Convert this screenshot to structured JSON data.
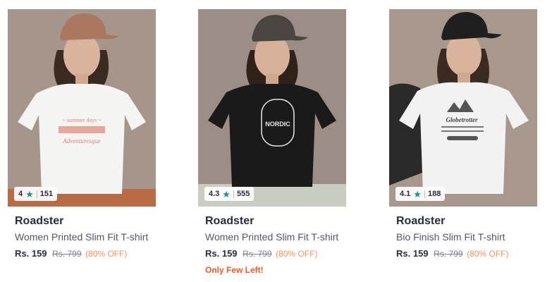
{
  "products": [
    {
      "brand": "Roadster",
      "title": "Women Printed Slim Fit T-shirt",
      "rating": "4",
      "rating_count": "151",
      "price": "Rs. 159",
      "mrp": "Rs. 799",
      "discount": "(80% OFF)",
      "stock_note": "",
      "image": {
        "shirt_color": "#f4f4f2",
        "cap_color": "#a9785f",
        "bottom_color": "#b86a45"
      }
    },
    {
      "brand": "Roadster",
      "title": "Women Printed Slim Fit T-shirt",
      "rating": "4.3",
      "rating_count": "555",
      "price": "Rs. 159",
      "mrp": "Rs. 799",
      "discount": "(80% OFF)",
      "stock_note": "Only Few Left!",
      "image": {
        "shirt_color": "#1a1a1a",
        "cap_color": "#4a4541",
        "bottom_color": "#c9ccc0"
      }
    },
    {
      "brand": "Roadster",
      "title": "Bio Finish Slim Fit T-shirt",
      "rating": "4.1",
      "rating_count": "188",
      "price": "Rs. 159",
      "mrp": "Rs. 799",
      "discount": "(80% OFF)",
      "stock_note": "",
      "image": {
        "shirt_color": "#f2f2f2",
        "cap_color": "#1f1f1f",
        "bottom_color": "#8a7f76"
      }
    }
  ],
  "colors": {
    "rating_star": "#14958f",
    "discount": "#ff905a",
    "few_left": "#ff5722",
    "brand": "#282c3f"
  }
}
